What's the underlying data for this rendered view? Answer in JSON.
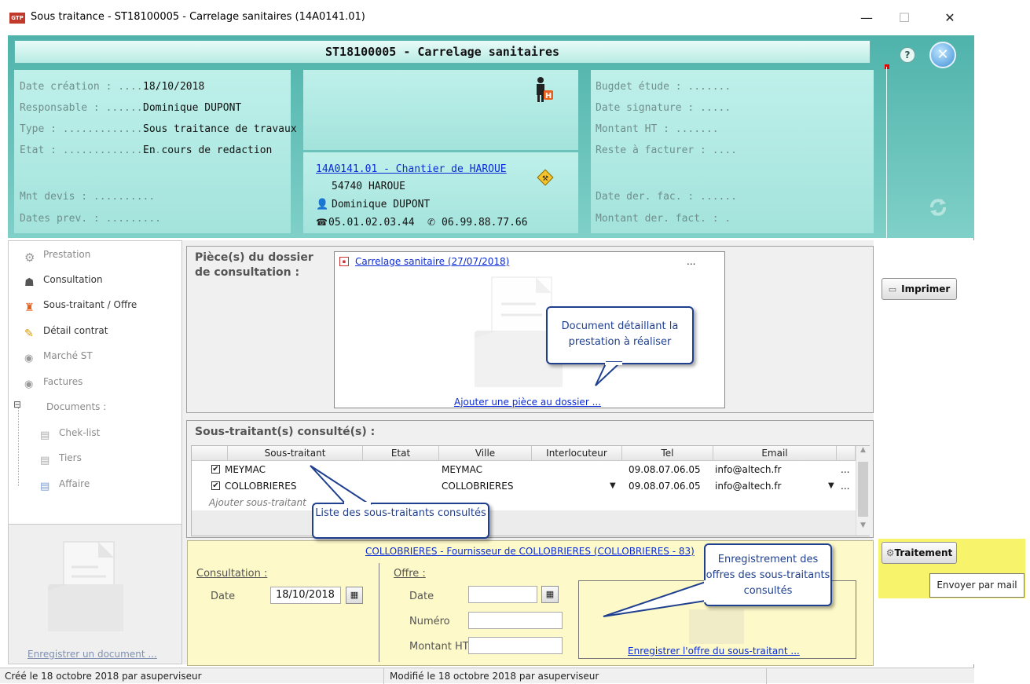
{
  "window": {
    "title": "Sous traitance - ST18100005 - Carrelage sanitaires (14A0141.01)",
    "app_icon_text": "GTP",
    "minimize": "—",
    "maximize": "☐",
    "close": "✕"
  },
  "header": {
    "title": "ST18100005 - Carrelage sanitaires",
    "left": {
      "date_creation_label": "Date création : .......",
      "date_creation_value": "18/10/2018",
      "responsable_label": "Responsable : ........",
      "responsable_value": "Dominique DUPONT",
      "type_label": "Type : ...............",
      "type_value": "Sous traitance de travaux",
      "etat_label": "Etat : ................",
      "etat_value": "En cours de redaction",
      "mnt_devis_label": "Mnt devis : ..........",
      "dates_prev_label": "Dates prev. : ........."
    },
    "chantier": {
      "link": "14A0141.01 - Chantier de HAROUE",
      "city": "54740 HAROUE",
      "contact": "Dominique DUPONT",
      "phone": "05.01.02.03.44",
      "mobile": "06.99.88.77.66"
    },
    "right": {
      "budget_label": "Bugdet étude : .......",
      "date_signature_label": "Date signature : .....",
      "montant_ht_label": "Montant HT : .......",
      "reste_label": "Reste à facturer : ....",
      "date_der_fac_label": "Date der. fac. : ......",
      "montant_der_label": "Montant der. fact. : ."
    }
  },
  "nav": {
    "items": [
      {
        "label": "Prestation"
      },
      {
        "label": "Consultation"
      },
      {
        "label": "Sous-traitant / Offre"
      },
      {
        "label": "Détail contrat"
      },
      {
        "label": "Marché ST"
      },
      {
        "label": "Factures"
      },
      {
        "label": "Documents :"
      },
      {
        "label": "Chek-list"
      },
      {
        "label": "Tiers"
      },
      {
        "label": "Affaire"
      }
    ],
    "tree_toggle": "⊟",
    "register_doc": "Enregistrer un document ..."
  },
  "pieces": {
    "title_line1": "Pièce(s) du dossier",
    "title_line2": "de consultation :",
    "doc_link": "Carrelage sanitaire (27/07/2018)",
    "more": "...",
    "add_link": "Ajouter une pièce au dossier ..."
  },
  "buttons": {
    "imprimer": "Imprimer",
    "traitement": "Traitement",
    "tooltip": "Envoyer par mail"
  },
  "subcontractors": {
    "title": "Sous-traitant(s) consulté(s) :",
    "columns": [
      "Sous-traitant",
      "Etat",
      "Ville",
      "Interlocuteur",
      "Tel",
      "Email"
    ],
    "rows": [
      {
        "checked": "✔",
        "name": "MEYMAC",
        "ville": "MEYMAC",
        "tel": "09.08.07.06.05",
        "email": "info@altech.fr",
        "more": "..."
      },
      {
        "checked": "✔",
        "name": "COLLOBRIERES",
        "ville": "COLLOBRIERES",
        "tel": "09.08.07.06.05",
        "email": "info@altech.fr",
        "more": "..."
      }
    ],
    "add_row": "Ajouter sous-traitant"
  },
  "offer": {
    "supplier_link": "COLLOBRIERES - Fournisseur de COLLOBRIERES (COLLOBRIERES - 83)",
    "consultation_label": "Consultation :",
    "date_label": "Date",
    "consultation_date": "18/10/2018",
    "offre_label": "Offre :",
    "offre_date_label": "Date",
    "numero_label": "Numéro",
    "montant_label": "Montant HT",
    "register_offer": "Enregistrer l'offre du sous-traitant ..."
  },
  "callouts": {
    "doc": "Document détaillant la prestation à réaliser",
    "list": "Liste des sous-traitants consultés",
    "offers": "Enregistrement des offres des sous-traitants consultés"
  },
  "status": {
    "created": "Créé le 18 octobre 2018 par asuperviseur",
    "modified": "Modifié le 18 octobre 2018 par asuperviseur"
  },
  "colors": {
    "header_teal": "#5fbfb7",
    "panel_mint": "#b3ebe4",
    "link_blue": "#0a2bd6",
    "callout_navy": "#1f3f8f",
    "offer_yellow": "#fdf9c9",
    "highlight_yellow": "#f7f36a"
  }
}
